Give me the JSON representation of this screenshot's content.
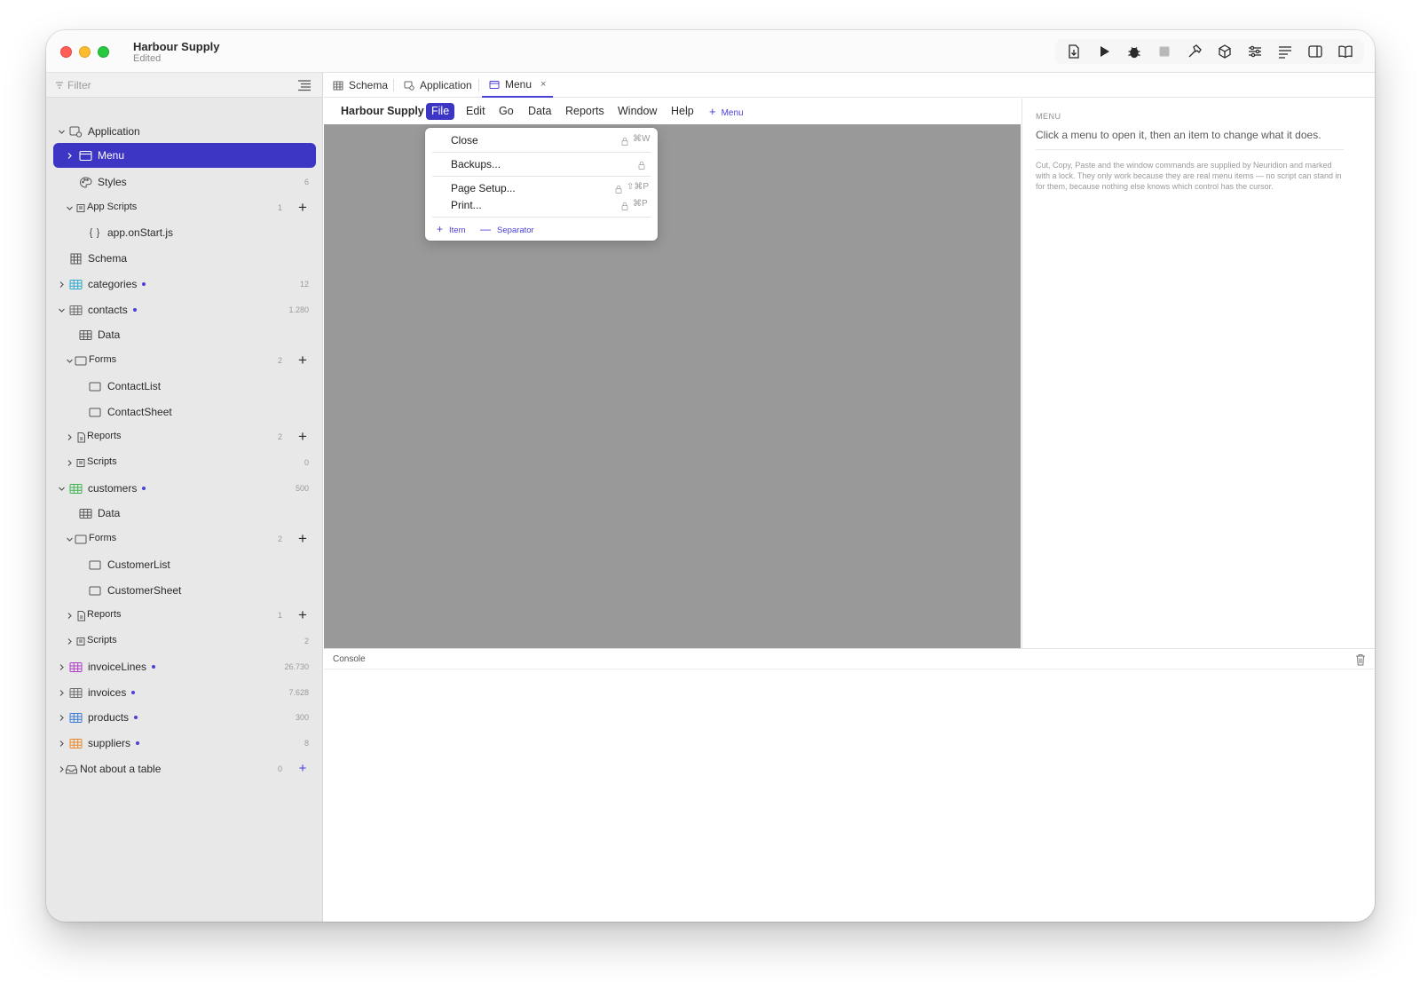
{
  "window": {
    "title": "Harbour Supply",
    "subtitle": "Edited"
  },
  "toolbar": {
    "buttons": [
      "export-icon",
      "play-icon",
      "bug-icon",
      "stop-icon",
      "hammer-icon",
      "package-icon",
      "sliders-icon",
      "text-align-icon",
      "sidebar-icon",
      "book-icon"
    ]
  },
  "sidebar": {
    "filter_placeholder": "Filter",
    "items": [
      {
        "label": "Application"
      },
      {
        "label": "Menu"
      },
      {
        "label": "Styles",
        "count": "6"
      },
      {
        "label": "App Scripts",
        "count": "1"
      },
      {
        "label": "app.onStart.js"
      },
      {
        "label": "Schema"
      },
      {
        "label": "categories",
        "count": "12"
      },
      {
        "label": "contacts",
        "count": "1.280"
      },
      {
        "label": "Data"
      },
      {
        "label": "Forms",
        "count": "2"
      },
      {
        "label": "ContactList"
      },
      {
        "label": "ContactSheet"
      },
      {
        "label": "Reports",
        "count": "2"
      },
      {
        "label": "Scripts",
        "count": "0"
      },
      {
        "label": "customers",
        "count": "500"
      },
      {
        "label": "Data"
      },
      {
        "label": "Forms",
        "count": "2"
      },
      {
        "label": "CustomerList"
      },
      {
        "label": "CustomerSheet"
      },
      {
        "label": "Reports",
        "count": "1"
      },
      {
        "label": "Scripts",
        "count": "2"
      },
      {
        "label": "invoiceLines",
        "count": "26.730"
      },
      {
        "label": "invoices",
        "count": "7.628"
      },
      {
        "label": "products",
        "count": "300"
      },
      {
        "label": "suppliers",
        "count": "8"
      },
      {
        "label": "Not about a table",
        "count": "0"
      }
    ],
    "table_colors": {
      "categories": "#2aa7c9",
      "contacts": "#6b6b6b",
      "customers": "#3fb34f",
      "invoiceLines": "#b03cc7",
      "invoices": "#6b6b6b",
      "products": "#3a7bd5",
      "suppliers": "#e8872a"
    }
  },
  "tabs": [
    {
      "label": "Schema"
    },
    {
      "label": "Application"
    },
    {
      "label": "Menu",
      "close": "×"
    }
  ],
  "menubar": {
    "app_name": "Harbour Supply",
    "menus": [
      "File",
      "Edit",
      "Go",
      "Data",
      "Reports",
      "Window",
      "Help"
    ],
    "add_label": "Menu",
    "add_symbol": "+"
  },
  "dropdown": {
    "items": [
      {
        "label": "Close",
        "shortcut": "⌘W"
      },
      {
        "label": "Backups..."
      },
      {
        "label": "Page Setup...",
        "shortcut": "⇧⌘P"
      },
      {
        "label": "Print...",
        "shortcut": "⌘P"
      }
    ],
    "add_item": "Item",
    "add_item_symbol": "+",
    "add_separator": "Separator",
    "add_separator_symbol": "—"
  },
  "inspector": {
    "heading": "MENU",
    "instruction": "Click a menu to open it, then an item to change what it does.",
    "note": "Cut, Copy, Paste and the window commands are supplied by Neuridion and marked with a lock. They only work because they are real menu items — no script can stand in for them, because nothing else knows which control has the cursor."
  },
  "console": {
    "label": "Console"
  },
  "colors": {
    "accent": "#3d35c4",
    "canvas": "#999999"
  }
}
